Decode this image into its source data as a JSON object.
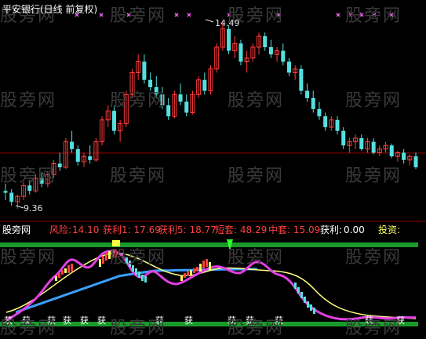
{
  "title": "平安银行(日线 前复权)",
  "colors": {
    "background": "#000000",
    "up": "#ff3a3a",
    "down": "#55e0e0",
    "divider": "#8b0000",
    "band": "#1a9a2a",
    "marker_x": "#ff66ff",
    "purple": "#e040e0",
    "yellow_line": "#ffff80",
    "blue_line": "#3aa0ff",
    "label_red": "#ff4040",
    "label_white": "#ffffff"
  },
  "watermark": "股旁网",
  "price_panel": {
    "high_label": "14.49",
    "low_label": "9.36"
  },
  "indicator_bar": {
    "name": "股旁网",
    "risk_label": "风险:",
    "risk_value": "14.10",
    "profit1": "获利1: 17.69",
    "profit5": "获利5: 18.77",
    "short_trap": "短套: 48.29",
    "mid_trap": "中套: 15.09",
    "profit_label": "获利:",
    "profit_value": "0.00",
    "invest_label": "投资:"
  },
  "signal_glyph": "获",
  "chart_data": {
    "type": "candlestick",
    "price_range": [
      9.36,
      14.49
    ],
    "annotations": [
      "14.49",
      "9.36"
    ],
    "candles": [
      [
        9.85,
        10.05,
        9.6,
        9.8
      ],
      [
        9.8,
        9.9,
        9.45,
        9.55
      ],
      [
        9.55,
        9.75,
        9.36,
        9.7
      ],
      [
        9.7,
        10.1,
        9.6,
        10.0
      ],
      [
        10.0,
        10.15,
        9.75,
        9.85
      ],
      [
        9.85,
        10.3,
        9.8,
        10.2
      ],
      [
        10.2,
        10.35,
        9.95,
        10.05
      ],
      [
        10.05,
        10.4,
        9.95,
        10.3
      ],
      [
        10.3,
        10.7,
        10.2,
        10.6
      ],
      [
        10.6,
        10.9,
        10.4,
        10.5
      ],
      [
        10.5,
        11.3,
        10.45,
        11.2
      ],
      [
        11.2,
        11.5,
        10.9,
        11.0
      ],
      [
        11.0,
        11.1,
        10.55,
        10.65
      ],
      [
        10.65,
        10.9,
        10.5,
        10.8
      ],
      [
        10.8,
        11.1,
        10.6,
        10.7
      ],
      [
        10.7,
        11.3,
        10.65,
        11.2
      ],
      [
        11.2,
        11.9,
        11.1,
        11.8
      ],
      [
        11.8,
        12.2,
        11.6,
        12.05
      ],
      [
        12.05,
        12.2,
        11.4,
        11.5
      ],
      [
        11.5,
        11.8,
        11.2,
        11.7
      ],
      [
        11.7,
        12.6,
        11.6,
        12.5
      ],
      [
        12.5,
        13.2,
        12.4,
        13.1
      ],
      [
        13.1,
        13.6,
        12.9,
        13.4
      ],
      [
        13.4,
        13.6,
        12.8,
        12.9
      ],
      [
        12.9,
        13.1,
        12.6,
        12.7
      ],
      [
        12.7,
        13.0,
        12.4,
        12.5
      ],
      [
        12.5,
        12.7,
        12.1,
        12.2
      ],
      [
        12.2,
        12.4,
        11.8,
        11.9
      ],
      [
        11.9,
        12.6,
        11.85,
        12.5
      ],
      [
        12.5,
        12.8,
        12.2,
        12.3
      ],
      [
        12.3,
        12.5,
        11.9,
        12.0
      ],
      [
        12.0,
        12.6,
        11.95,
        12.5
      ],
      [
        12.5,
        13.0,
        12.4,
        12.9
      ],
      [
        12.9,
        13.1,
        12.5,
        12.6
      ],
      [
        12.6,
        13.3,
        12.5,
        13.2
      ],
      [
        13.2,
        13.9,
        13.1,
        13.8
      ],
      [
        13.8,
        14.49,
        13.7,
        14.3
      ],
      [
        14.3,
        14.4,
        13.6,
        13.7
      ],
      [
        13.7,
        14.1,
        13.5,
        13.9
      ],
      [
        13.9,
        14.0,
        13.3,
        13.4
      ],
      [
        13.4,
        13.7,
        13.1,
        13.5
      ],
      [
        13.5,
        13.9,
        13.4,
        13.8
      ],
      [
        13.8,
        14.2,
        13.6,
        14.1
      ],
      [
        14.1,
        14.2,
        13.7,
        13.8
      ],
      [
        13.8,
        14.0,
        13.5,
        13.6
      ],
      [
        13.6,
        13.8,
        13.4,
        13.7
      ],
      [
        13.7,
        13.9,
        13.3,
        13.4
      ],
      [
        13.4,
        13.5,
        13.0,
        13.1
      ],
      [
        13.1,
        13.3,
        12.9,
        13.2
      ],
      [
        13.2,
        13.3,
        12.5,
        12.6
      ],
      [
        12.6,
        12.8,
        12.3,
        12.4
      ],
      [
        12.4,
        12.6,
        12.0,
        12.1
      ],
      [
        12.1,
        12.3,
        11.8,
        11.9
      ],
      [
        11.9,
        12.0,
        11.5,
        11.6
      ],
      [
        11.6,
        11.9,
        11.5,
        11.8
      ],
      [
        11.8,
        11.9,
        11.4,
        11.5
      ],
      [
        11.5,
        11.6,
        11.0,
        11.1
      ],
      [
        11.1,
        11.3,
        10.9,
        11.2
      ],
      [
        11.2,
        11.4,
        11.0,
        11.3
      ],
      [
        11.3,
        11.4,
        10.95,
        11.0
      ],
      [
        11.0,
        11.3,
        10.9,
        11.2
      ],
      [
        11.2,
        11.3,
        10.85,
        10.9
      ],
      [
        10.9,
        11.1,
        10.8,
        11.0
      ],
      [
        11.0,
        11.2,
        10.9,
        11.1
      ],
      [
        11.1,
        11.15,
        10.75,
        10.8
      ],
      [
        10.8,
        10.95,
        10.65,
        10.9
      ],
      [
        10.9,
        11.0,
        10.6,
        10.7
      ],
      [
        10.7,
        10.85,
        10.55,
        10.8
      ],
      [
        10.8,
        10.9,
        10.45,
        10.5
      ]
    ]
  }
}
